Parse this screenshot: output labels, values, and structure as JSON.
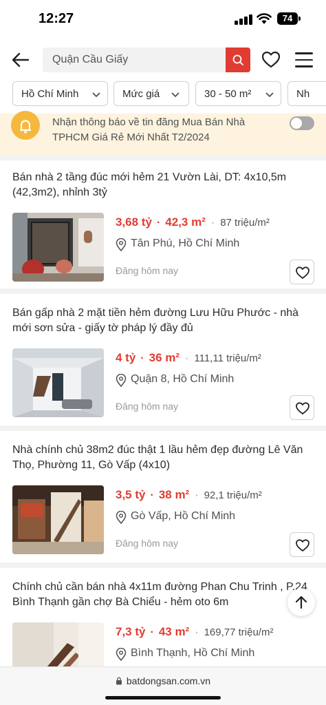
{
  "status_bar": {
    "time": "12:27",
    "battery": "74"
  },
  "header": {
    "search_text": "Quận Cầu Giấy"
  },
  "filters": [
    {
      "label": "Hồ Chí Minh"
    },
    {
      "label": "Mức giá"
    },
    {
      "label": "30 - 50 m²"
    },
    {
      "label": "Nh"
    }
  ],
  "notify": {
    "text": "Nhận thông báo về tin đăng Mua Bán Nhà TPHCM Giá Rẻ Mới Nhất T2/2024"
  },
  "listings": [
    {
      "title": "Bán nhà 2 tầng đúc mới hẻm 21 Vườn Lài, DT: 4x10,5m (42,3m2), nhỉnh 3tỷ",
      "price": "3,68 tỷ",
      "area": "42,3 m²",
      "price_per_m2": "87 triệu/m²",
      "location": "Tân Phú, Hồ Chí Minh",
      "posted": "Đăng hôm nay"
    },
    {
      "title": "Bán gấp nhà 2 mặt tiền hẻm đường Lưu Hữu Phước - nhà mới sơn sửa - giấy tờ pháp lý đầy đủ",
      "price": "4 tỷ",
      "area": "36 m²",
      "price_per_m2": "111,11 triệu/m²",
      "location": "Quận 8, Hồ Chí Minh",
      "posted": "Đăng hôm nay"
    },
    {
      "title": "Nhà chính chủ 38m2 đúc thật 1 lầu hẻm đẹp đường Lê Văn Thọ, Phường 11, Gò Vấp (4x10)",
      "price": "3,5 tỷ",
      "area": "38 m²",
      "price_per_m2": "92,1 triệu/m²",
      "location": "Gò Vấp, Hồ Chí Minh",
      "posted": "Đăng hôm nay"
    },
    {
      "title": "Chính chủ cần bán nhà 4x11m đường Phan Chu Trinh , P.24 Bình Thạnh gần chợ Bà Chiểu - hẻm oto 6m",
      "price": "7,3 tỷ",
      "area": "43 m²",
      "price_per_m2": "169,77 triệu/m²",
      "location": "Bình Thạnh, Hồ Chí Minh",
      "posted": ""
    }
  ],
  "url_bar": {
    "url": "batdongsan.com.vn"
  }
}
